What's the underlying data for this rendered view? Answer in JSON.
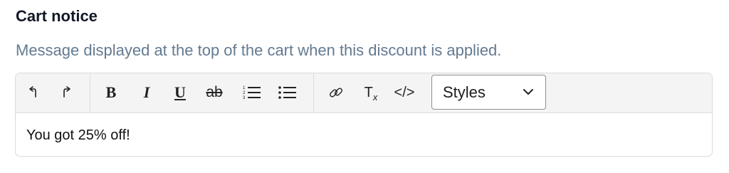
{
  "field": {
    "label": "Cart notice",
    "help": "Message displayed at the top of the cart when this discount is applied."
  },
  "toolbar": {
    "undo_icon": "undo-icon",
    "redo_icon": "redo-icon",
    "bold_label": "B",
    "italic_label": "I",
    "underline_label": "U",
    "strike_label": "ab",
    "ordered_list_icon": "ordered-list-icon",
    "bullet_list_icon": "bullet-list-icon",
    "link_icon": "link-icon",
    "clear_format_label": "T",
    "clear_format_sub": "x",
    "code_label": "</>",
    "styles_select": {
      "value": "Styles"
    }
  },
  "editor": {
    "content": "You got 25% off!"
  },
  "colors": {
    "label": "#111827",
    "help_text": "#637a91",
    "toolbar_bg": "#f4f4f5",
    "border": "#d7dbe0"
  }
}
